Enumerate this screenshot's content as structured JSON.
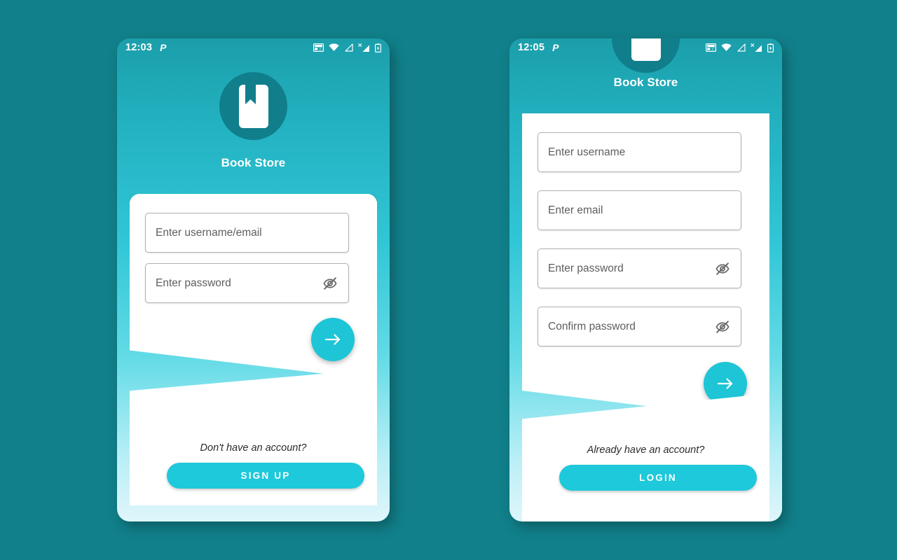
{
  "background": {
    "color": "#11808a"
  },
  "theme": {
    "screen_gradient_top": "#1b9eaa",
    "screen_gradient_mid": "#30c6d6",
    "screen_gradient_bottom": "#dff6fb",
    "logo_circle": "#117e8c",
    "accent_button": "#1dc9da",
    "fab": "#1dc5d6",
    "card": "#ffffff",
    "placeholder_text": "#5e5e5e",
    "field_border": "#b0b0b0"
  },
  "screens": [
    {
      "id": "login",
      "statusbar": {
        "time": "12:03",
        "p_icon": "P",
        "icons": [
          "volte-icon",
          "wifi-icon",
          "signal-empty-icon",
          "signal-x-icon",
          "battery-charging-icon"
        ]
      },
      "header": {
        "logo_icon": "book-bookmark-icon",
        "title": "Book Store"
      },
      "form": {
        "fields": [
          {
            "placeholder": "Enter username/email",
            "has_eye": false
          },
          {
            "placeholder": "Enter password",
            "has_eye": true,
            "eye_icon": "eye-off-icon"
          }
        ],
        "submit_icon": "arrow-right-icon"
      },
      "alt": {
        "prompt": "Don't have an account?",
        "button_label": "SIGN UP"
      }
    },
    {
      "id": "signup",
      "statusbar": {
        "time": "12:05",
        "p_icon": "P",
        "icons": [
          "volte-icon",
          "wifi-icon",
          "signal-empty-icon",
          "signal-x-icon",
          "battery-charging-icon"
        ]
      },
      "header": {
        "logo_icon": "book-bookmark-icon",
        "title": "Book Store"
      },
      "form": {
        "fields": [
          {
            "placeholder": "Enter username",
            "has_eye": false
          },
          {
            "placeholder": "Enter email",
            "has_eye": false
          },
          {
            "placeholder": "Enter password",
            "has_eye": true,
            "eye_icon": "eye-off-icon"
          },
          {
            "placeholder": "Confirm password",
            "has_eye": true,
            "eye_icon": "eye-off-icon"
          }
        ],
        "submit_icon": "arrow-right-icon"
      },
      "alt": {
        "prompt": "Already have an account?",
        "button_label": "LOGIN"
      }
    }
  ]
}
